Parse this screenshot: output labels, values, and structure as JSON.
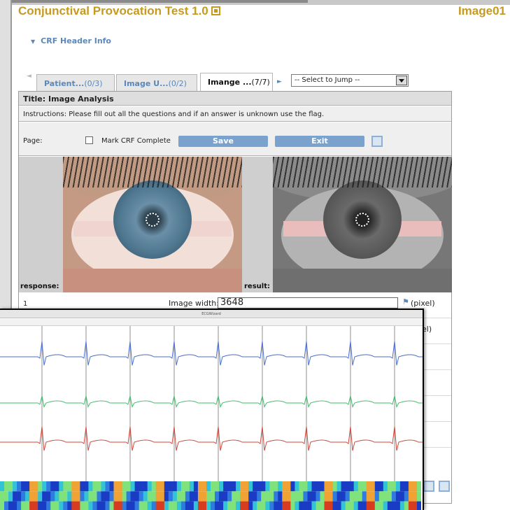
{
  "app": {
    "title": "Conjunctival Provocation Test 1.0",
    "image_id": "Image01"
  },
  "crf_header": {
    "label": "CRF Header Info"
  },
  "tabs": [
    {
      "label": "Patient...",
      "count": "(0/3)",
      "active": false
    },
    {
      "label": "Image U...",
      "count": "(0/2)",
      "active": false
    },
    {
      "label": "Imange ...",
      "count": "(7/7)",
      "active": true
    }
  ],
  "jump_select": {
    "selected": "-- Select to Jump --"
  },
  "form": {
    "title": "Title: Image Analysis",
    "instructions": "Instructions:  Please fill out all the questions and if an answer is unknown use the flag.",
    "page_label": "Page:",
    "mark_complete_label": "Mark CRF Complete",
    "save_label": "Save",
    "exit_label": "Exit"
  },
  "images": {
    "left_label": "response:",
    "right_label": "result:"
  },
  "questions": [
    {
      "number": "1",
      "label": "Image width:",
      "value": "3648",
      "unit": "(pixel)"
    },
    {
      "number": "",
      "label": "",
      "value": "",
      "unit": "el)"
    }
  ],
  "ecg_window": {
    "title": "ECGWizard",
    "lead_colors": [
      "#4a6fd1",
      "#3fbf6a",
      "#d0473a"
    ],
    "beats": 9
  },
  "colors": {
    "title_gold": "#c79a1f",
    "link_blue": "#5b88b8",
    "button_blue": "#7aa2cd"
  }
}
